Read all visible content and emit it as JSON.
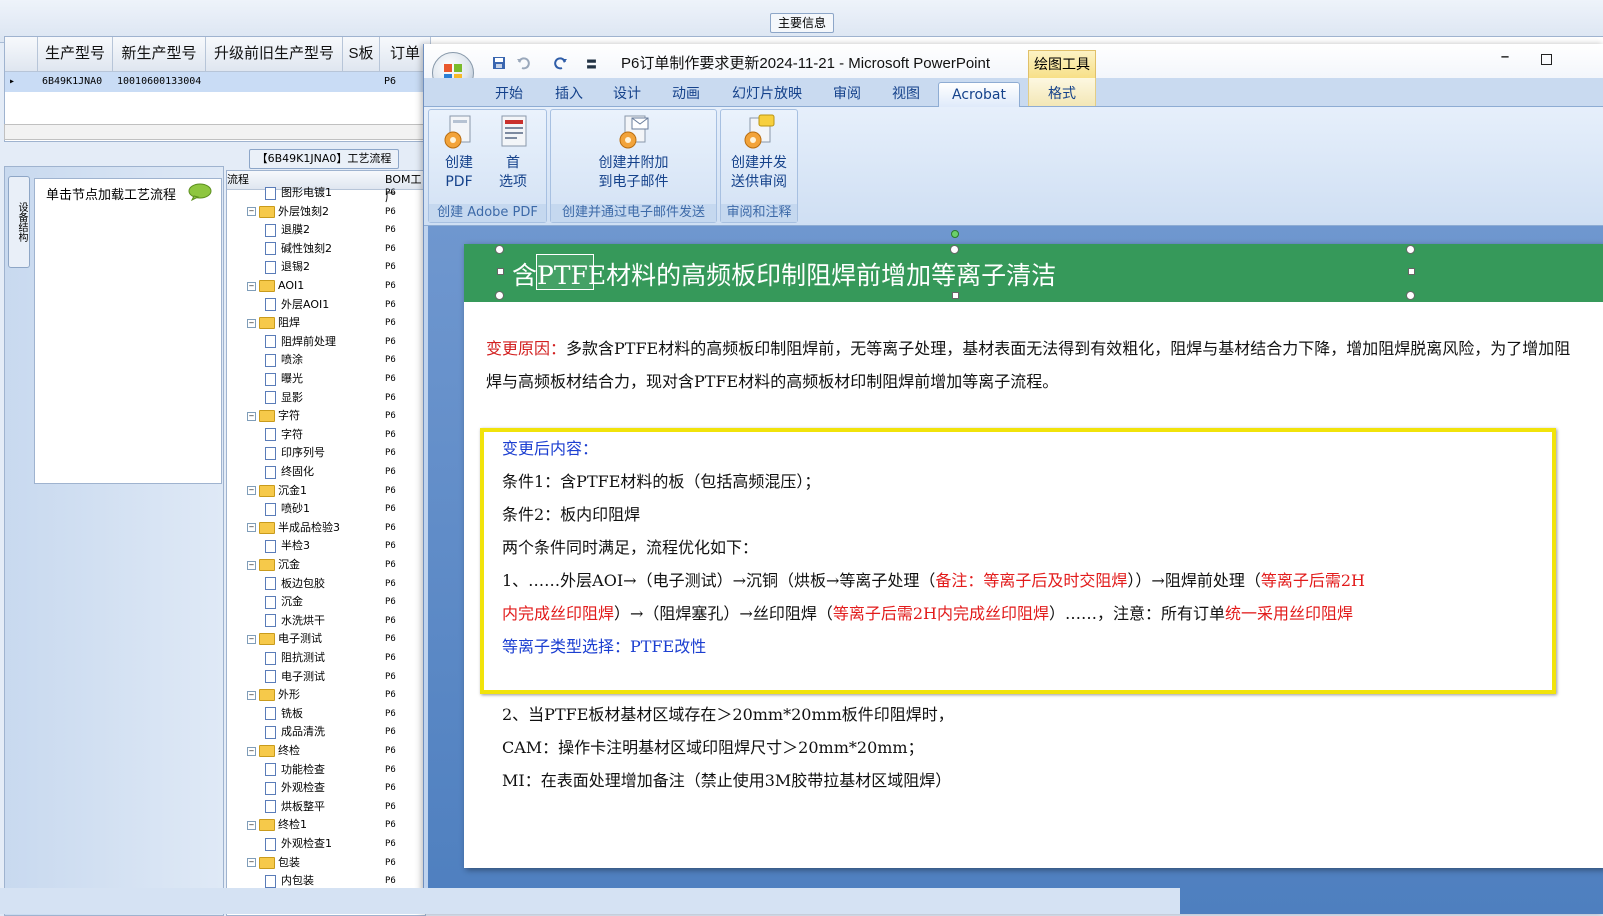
{
  "erp": {
    "main_info_title": "主要信息",
    "grid_columns": [
      "生产型号",
      "新生产型号",
      "升级前旧生产型号",
      "S板",
      "订单"
    ],
    "grid_row": {
      "model": "6B49K1JNA0",
      "new_model": "10010600133004",
      "s_board": "P6"
    },
    "process_title": "【6B49K1JNA0】工艺流程",
    "vertical_tab": "设备结构",
    "node_hint": "单击节点加载工艺流程",
    "tree_columns": [
      "流程",
      "BOM工厂"
    ],
    "tree": [
      {
        "label": "图形电镀1",
        "level": 2,
        "kind": "doc",
        "bom": "P6"
      },
      {
        "label": "外层蚀刻2",
        "level": 1,
        "kind": "folder",
        "bom": "P6"
      },
      {
        "label": "退膜2",
        "level": 2,
        "kind": "doc",
        "bom": "P6"
      },
      {
        "label": "碱性蚀刻2",
        "level": 2,
        "kind": "doc",
        "bom": "P6"
      },
      {
        "label": "退锡2",
        "level": 2,
        "kind": "doc",
        "bom": "P6"
      },
      {
        "label": "AOI1",
        "level": 1,
        "kind": "folder",
        "bom": "P6"
      },
      {
        "label": "外层AOI1",
        "level": 2,
        "kind": "doc",
        "bom": "P6"
      },
      {
        "label": "阻焊",
        "level": 1,
        "kind": "folder",
        "bom": "P6"
      },
      {
        "label": "阻焊前处理",
        "level": 2,
        "kind": "doc",
        "bom": "P6"
      },
      {
        "label": "喷涂",
        "level": 2,
        "kind": "doc",
        "bom": "P6"
      },
      {
        "label": "曝光",
        "level": 2,
        "kind": "doc",
        "bom": "P6"
      },
      {
        "label": "显影",
        "level": 2,
        "kind": "doc",
        "bom": "P6"
      },
      {
        "label": "字符",
        "level": 1,
        "kind": "folder",
        "bom": "P6"
      },
      {
        "label": "字符",
        "level": 2,
        "kind": "doc",
        "bom": "P6"
      },
      {
        "label": "印序列号",
        "level": 2,
        "kind": "doc",
        "bom": "P6"
      },
      {
        "label": "终固化",
        "level": 2,
        "kind": "doc",
        "bom": "P6"
      },
      {
        "label": "沉金1",
        "level": 1,
        "kind": "folder",
        "bom": "P6"
      },
      {
        "label": "喷砂1",
        "level": 2,
        "kind": "doc",
        "bom": "P6"
      },
      {
        "label": "半成品检验3",
        "level": 1,
        "kind": "folder",
        "bom": "P6"
      },
      {
        "label": "半检3",
        "level": 2,
        "kind": "doc",
        "bom": "P6"
      },
      {
        "label": "沉金",
        "level": 1,
        "kind": "folder",
        "bom": "P6"
      },
      {
        "label": "板边包胶",
        "level": 2,
        "kind": "doc",
        "bom": "P6"
      },
      {
        "label": "沉金",
        "level": 2,
        "kind": "doc",
        "bom": "P6"
      },
      {
        "label": "水洗烘干",
        "level": 2,
        "kind": "doc",
        "bom": "P6"
      },
      {
        "label": "电子测试",
        "level": 1,
        "kind": "folder",
        "bom": "P6"
      },
      {
        "label": "阻抗测试",
        "level": 2,
        "kind": "doc",
        "bom": "P6"
      },
      {
        "label": "电子测试",
        "level": 2,
        "kind": "doc",
        "bom": "P6"
      },
      {
        "label": "外形",
        "level": 1,
        "kind": "folder",
        "bom": "P6"
      },
      {
        "label": "铣板",
        "level": 2,
        "kind": "doc",
        "bom": "P6"
      },
      {
        "label": "成品清洗",
        "level": 2,
        "kind": "doc",
        "bom": "P6"
      },
      {
        "label": "终检",
        "level": 1,
        "kind": "folder",
        "bom": "P6"
      },
      {
        "label": "功能检查",
        "level": 2,
        "kind": "doc",
        "bom": "P6"
      },
      {
        "label": "外观检查",
        "level": 2,
        "kind": "doc",
        "bom": "P6"
      },
      {
        "label": "烘板整平",
        "level": 2,
        "kind": "doc",
        "bom": "P6"
      },
      {
        "label": "终检1",
        "level": 1,
        "kind": "folder",
        "bom": "P6"
      },
      {
        "label": "外观检查1",
        "level": 2,
        "kind": "doc",
        "bom": "P6"
      },
      {
        "label": "包装",
        "level": 1,
        "kind": "folder",
        "bom": "P6"
      },
      {
        "label": "内包装",
        "level": 2,
        "kind": "doc",
        "bom": "P6"
      }
    ]
  },
  "ppt": {
    "window_title": "P6订单制作要求更新2024-11-21 - Microsoft PowerPoint",
    "context_tools": "绘图工具",
    "tabs": [
      "开始",
      "插入",
      "设计",
      "动画",
      "幻灯片放映",
      "审阅",
      "视图",
      "Acrobat",
      "格式"
    ],
    "active_tab": "Acrobat",
    "groups": [
      {
        "label": "创建 Adobe PDF",
        "buttons": [
          [
            "创建",
            "PDF"
          ],
          [
            "首",
            "选项"
          ]
        ]
      },
      {
        "label": "创建并通过电子邮件发送",
        "buttons": [
          [
            "创建并附加",
            "到电子邮件"
          ]
        ]
      },
      {
        "label": "审阅和注释",
        "buttons": [
          [
            "创建并发",
            "送供审阅"
          ]
        ]
      }
    ],
    "slide": {
      "title_prefix": "含",
      "title_sel": "PTFE",
      "title_suffix": "材料的高频板印制阻焊前增加等离子清洁",
      "reason_label": "变更原因：",
      "reason_text": "多款含PTFE材料的高频板印制阻焊前，无等离子处理，基材表面无法得到有效粗化，阻焊与基材结合力下降，增加阻焊脱离风险，为了增加阻焊与高频板材结合力，现对含PTFE材料的高频板材印制阻焊前增加等离子流程。",
      "after_title": "变更后内容：",
      "cond1": "条件1：含PTFE材料的板（包括高频混压）；",
      "cond2": "条件2：板内印阻焊",
      "both": "两个条件同时满足，流程优化如下：",
      "flow_a": "1、……外层AOI→（电子测试）→沉铜（烘板→等离子处理（",
      "flow_b": "备注：等离子后及时交阻焊",
      "flow_c": "））→阻焊前处理（",
      "flow_d": "等离子后需2H",
      "flow_e": "内完成丝印阻焊",
      "flow_f": "）→（阻焊塞孔）→丝印阻焊（",
      "flow_g": "等离子后需2H内完成丝印阻焊",
      "flow_h": "）……，注意：所有订单",
      "flow_i": "统一采用丝印阻焊",
      "plasma": "等离子类型选择：PTFE改性",
      "item2": "2、当PTFE板材基材区域存在＞20mm*20mm板件印阻焊时，",
      "cam": "CAM：操作卡注明基材区域印阻焊尺寸＞20mm*20mm；",
      "mi": "MI：在表面处理增加备注（禁止使用3M胶带拉基材区域阻焊）"
    }
  },
  "colors": {
    "slide_header": "#36995a",
    "highlight_box": "#f1e30b",
    "red_text": "#e21b1b",
    "blue_text": "#1c3fd1"
  }
}
